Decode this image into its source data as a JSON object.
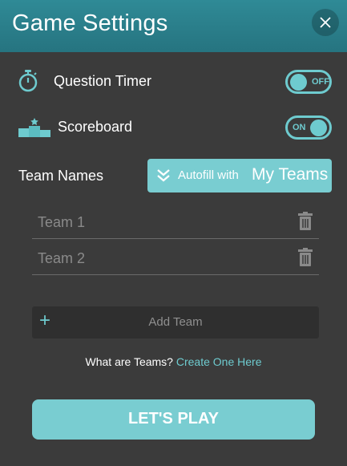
{
  "header": {
    "title": "Game Settings"
  },
  "settings": {
    "question_timer": {
      "label": "Question Timer",
      "state": "OFF"
    },
    "scoreboard": {
      "label": "Scoreboard",
      "state": "ON"
    }
  },
  "teams": {
    "label": "Team Names",
    "autofill_prefix": "Autofill with",
    "autofill_source": "My Teams",
    "fields": [
      {
        "placeholder": "Team 1"
      },
      {
        "placeholder": "Team 2"
      }
    ],
    "add_label": "Add Team",
    "info_question": "What are Teams?",
    "info_link": "Create One Here"
  },
  "play_button": {
    "label": "LET'S PLAY"
  },
  "colors": {
    "accent": "#6ecbcf",
    "header": "#2f8a96",
    "background": "#3b3b3b"
  }
}
